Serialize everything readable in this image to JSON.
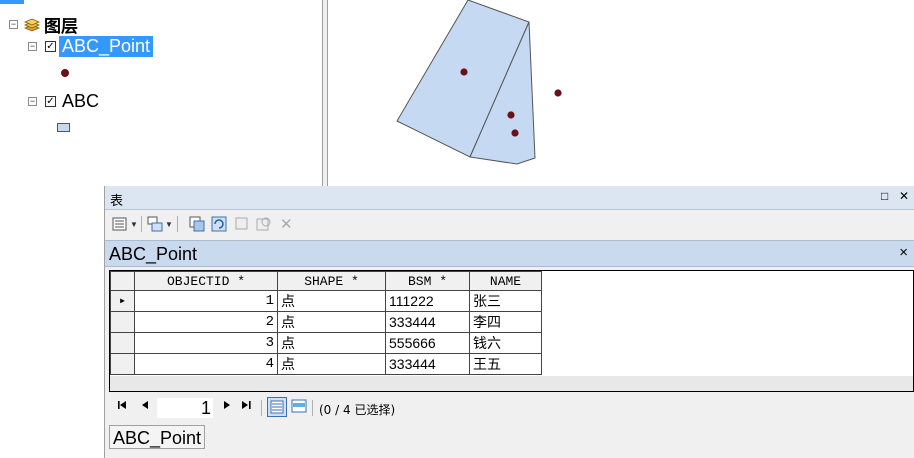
{
  "toc": {
    "root_label": "图层",
    "layers": [
      {
        "label": "ABC_Point",
        "checked": true,
        "selected": true,
        "symbol": "point"
      },
      {
        "label": "ABC",
        "checked": true,
        "selected": false,
        "symbol": "polygon"
      }
    ]
  },
  "map": {
    "polygon_fill": "#c5daf2",
    "polygon_stroke": "#555555",
    "point_color": "#6b0f1a"
  },
  "table_window": {
    "title": "表",
    "minimize_glyph": "□",
    "close_glyph": "✕",
    "toolbar_icons": [
      "table-options-icon",
      "related-tables-icon",
      "select-by-attributes-icon",
      "switch-selection-icon",
      "clear-selection-icon",
      "zoom-to-selected-icon",
      "delete-selected-icon"
    ],
    "tab_name": "ABC_Point",
    "tab_close_glyph": "×",
    "columns": [
      "OBJECTID *",
      "SHAPE *",
      "BSM *",
      "NAME"
    ],
    "rows": [
      {
        "objectid": "1",
        "shape": "点",
        "bsm": "111222",
        "name": "张三",
        "current": true
      },
      {
        "objectid": "2",
        "shape": "点",
        "bsm": "333444",
        "name": "李四",
        "current": false
      },
      {
        "objectid": "3",
        "shape": "点",
        "bsm": "555666",
        "name": "钱六",
        "current": false
      },
      {
        "objectid": "4",
        "shape": "点",
        "bsm": "333444",
        "name": "王五",
        "current": false
      }
    ],
    "nav": {
      "first": "⏮",
      "prev": "◀",
      "next": "▶",
      "last": "⏭",
      "page": "1"
    },
    "selection_status": "(0 / 4 已选择)",
    "bottom_tab": "ABC_Point"
  }
}
